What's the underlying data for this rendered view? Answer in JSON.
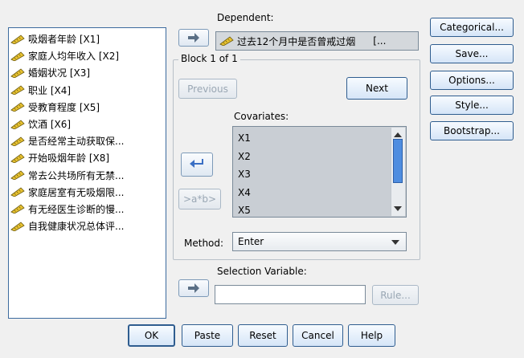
{
  "variables": [
    "吸烟者年龄 [X1]",
    "家庭人均年收入 [X2]",
    "婚姻状况 [X3]",
    "职业 [X4]",
    "受教育程度 [X5]",
    "饮酒 [X6]",
    "是否经常主动获取保...",
    "开始吸烟年龄 [X8]",
    "常去公共场所有无禁...",
    "家庭居室有无吸烟限...",
    "有无经医生诊断的慢...",
    "自我健康状况总体评..."
  ],
  "dependent": {
    "label": "Dependent:",
    "value": "过去12个月中是否曾戒过烟",
    "suffix": "[..."
  },
  "block": {
    "title": "Block 1 of 1",
    "previous": "Previous",
    "next": "Next"
  },
  "covariates": {
    "label": "Covariates:",
    "items": [
      "X1",
      "X2",
      "X3",
      "X4",
      "X5"
    ]
  },
  "interaction_button": ">a*b>",
  "method": {
    "label": "Method:",
    "value": "Enter"
  },
  "selection": {
    "label": "Selection Variable:",
    "value": "",
    "rule": "Rule..."
  },
  "side_buttons": [
    "Categorical...",
    "Save...",
    "Options...",
    "Style...",
    "Bootstrap..."
  ],
  "bottom_buttons": [
    "OK",
    "Paste",
    "Reset",
    "Cancel",
    "Help"
  ],
  "colors": {
    "accent": "#2f5d8f",
    "list_border": "#3c6a9e",
    "dependent_bg": "#d4d8dc",
    "covariates_bg": "#c9ced4",
    "arrow_blue": "#3a6fc4"
  }
}
